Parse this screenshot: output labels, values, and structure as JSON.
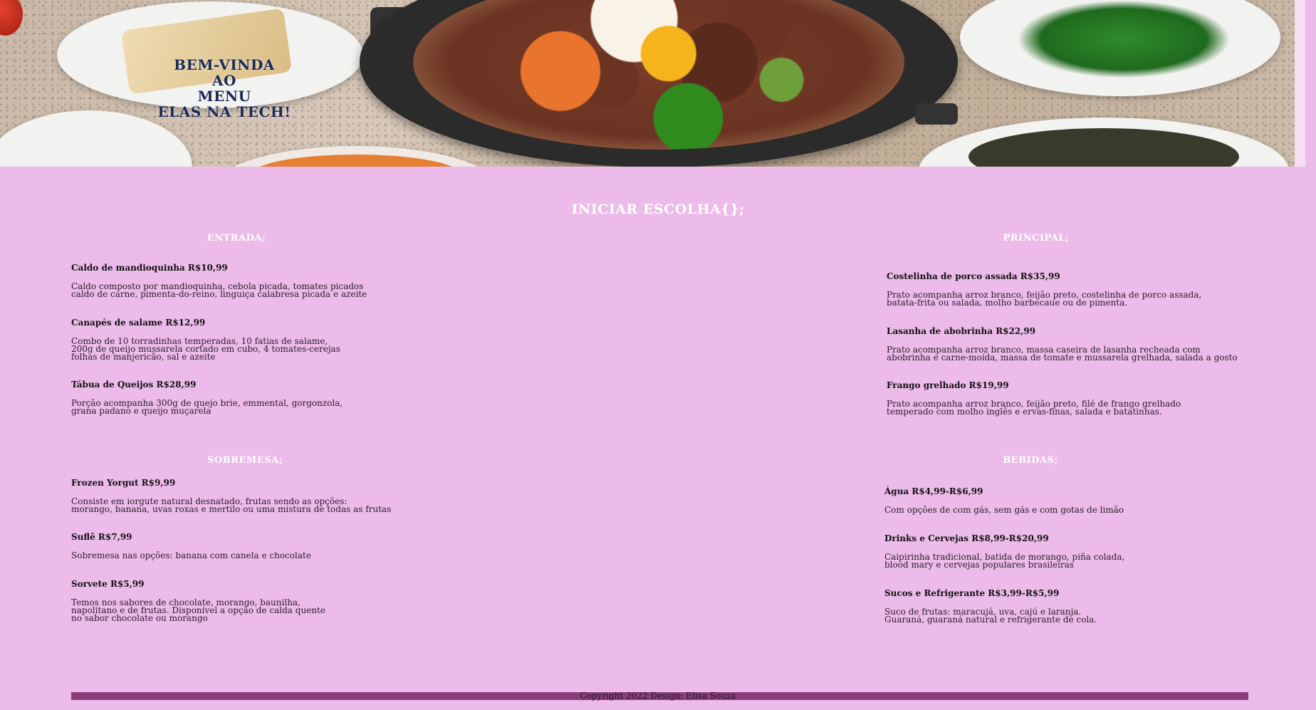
{
  "hero": {
    "title_lines": [
      "BEM-VINDA",
      "AO",
      "MENU",
      "ELAS NA TECH!"
    ]
  },
  "menu": {
    "heading": "INICIAR ESCOLHA{};",
    "sections": {
      "entrada": {
        "title": "ENTRADA;",
        "items": [
          {
            "name": "Caldo de mandioquinha R$10,99",
            "desc": "Caldo composto por mandioquinha, cebola picada, tomates picados\ncaldo de carne, pimenta-do-reino, linguiça calabresa picada e azeite"
          },
          {
            "name": "Canapés de salame R$12,99",
            "desc": "Combo de 10 torradinhas temperadas, 10 fatias de salame,\n200g de queijo mussarela cortado em cubo, 4 tomates-cerejas\nfolhas de manjericão, sal e azeite"
          },
          {
            "name": "Tábua de Queijos R$28,99",
            "desc": "Porção acompanha 300g de quejo brie, emmental, gorgonzola,\ngrana padano e queijo muçarela"
          }
        ]
      },
      "principal": {
        "title": "PRINCIPAL;",
        "items": [
          {
            "name": "Costelinha de porco assada R$35,99",
            "desc": "Prato acompanha arroz branco, feijão preto, costelinha de porco assada,\nbatata-frita ou salada, molho barbecaue ou de pimenta."
          },
          {
            "name": "Lasanha de abobrinha R$22,99",
            "desc": "Prato acompanha arroz branco, massa caseira de lasanha recheada com\nabobrinha e carne-moída, massa de tomate e mussarela grelhada, salada a gosto"
          },
          {
            "name": "Frango grelhado R$19,99",
            "desc": "Prato acompanha arroz branco, feijão preto, filé de frango grelhado\ntemperado com molho inglês e ervas-finas, salada e batatinhas."
          }
        ]
      },
      "sobremesa": {
        "title": "SOBREMESA;",
        "items": [
          {
            "name": "Frozen Yorgut R$9,99",
            "desc": "Consiste em iorgute natural desnatado, frutas sendo as opções:\nmorango, banana, uvas roxas e mertilo ou uma mistura de todas as frutas"
          },
          {
            "name": "Suflê R$7,99",
            "desc": "Sobremesa nas opções: banana com canela e chocolate"
          },
          {
            "name": "Sorvete R$5,99",
            "desc": "Temos nos sabores de chocolate, morango, baunilha,\nnapolitano e de frutas. Disponível a opção de calda quente\nno sabor chocolate ou morango"
          }
        ]
      },
      "bebidas": {
        "title": "BEBIDAS;",
        "items": [
          {
            "name": "Água R$4,99-R$6,99",
            "desc": "Com opções de com gás, sem gás e com gotas de limão"
          },
          {
            "name": "Drinks e Cervejas R$8,99-R$20,99",
            "desc": "Caipirinha tradicional, batida de morango, piña colada,\nblood mary e cervejas populares brasileiras"
          },
          {
            "name": "Sucos e Refrigerante R$3,99-R$5,99",
            "desc": "Suco de frutas: maracujá, uva, cajú e laranja.\nGuaraná, guaraná natural e refrigerante de cola."
          }
        ]
      }
    }
  },
  "footer": {
    "text": "Copyright 2022 Design: Elisa Souza"
  },
  "colors": {
    "background": "#ecbbe9",
    "footer_bar": "#8a3d7d",
    "heading_text": "#ffffff",
    "hero_title": "#1c2a55"
  }
}
